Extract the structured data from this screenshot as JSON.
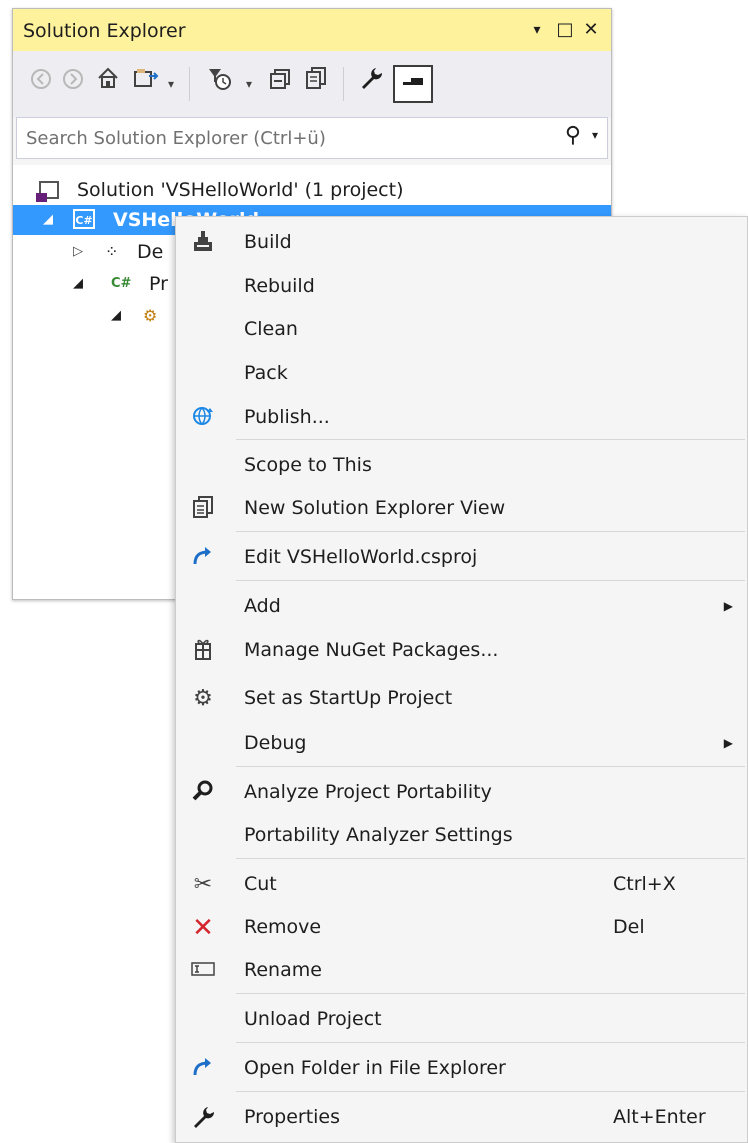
{
  "panel": {
    "title": "Solution Explorer",
    "window_buttons": {
      "dropdown": "▾",
      "maximize": "□",
      "close": "✕"
    },
    "search_placeholder": "Search Solution Explorer (Ctrl+ü)",
    "search_icon": "⚲"
  },
  "toolbar_icons": [
    "back-icon",
    "forward-icon",
    "home-icon",
    "sync-with-document-icon",
    "dropdown-icon",
    "pending-changes-filter-icon",
    "dropdown-icon",
    "collapse-all-icon",
    "show-all-files-icon",
    "properties-wrench-icon",
    "preview-selected-items-icon"
  ],
  "tree": {
    "solution_label": "Solution 'VSHelloWorld' (1 project)",
    "project_label": "VSHelloWorld",
    "project_icon_text": "C#",
    "dependencies_label": "De",
    "properties_label": "Pr",
    "properties_icon_text": "C#"
  },
  "context_menu": {
    "build": "Build",
    "rebuild": "Rebuild",
    "clean": "Clean",
    "pack": "Pack",
    "publish": "Publish...",
    "scope_to_this": "Scope to This",
    "new_view": "New Solution Explorer View",
    "edit_csproj": "Edit VSHelloWorld.csproj",
    "add": "Add",
    "manage_nuget": "Manage NuGet Packages...",
    "set_startup": "Set as StartUp Project",
    "debug": "Debug",
    "analyze_portability": "Analyze Project Portability",
    "portability_settings": "Portability Analyzer Settings",
    "cut": "Cut",
    "cut_shortcut": "Ctrl+X",
    "remove": "Remove",
    "remove_shortcut": "Del",
    "rename": "Rename",
    "unload": "Unload Project",
    "open_folder": "Open Folder in File Explorer",
    "properties": "Properties",
    "properties_shortcut": "Alt+Enter",
    "submenu_arrow": "▶"
  },
  "colors": {
    "title_bar": "#fff29d",
    "selection": "#3399ff",
    "remove_icon": "#d4252f",
    "accent_blue": "#1e6fc8"
  }
}
